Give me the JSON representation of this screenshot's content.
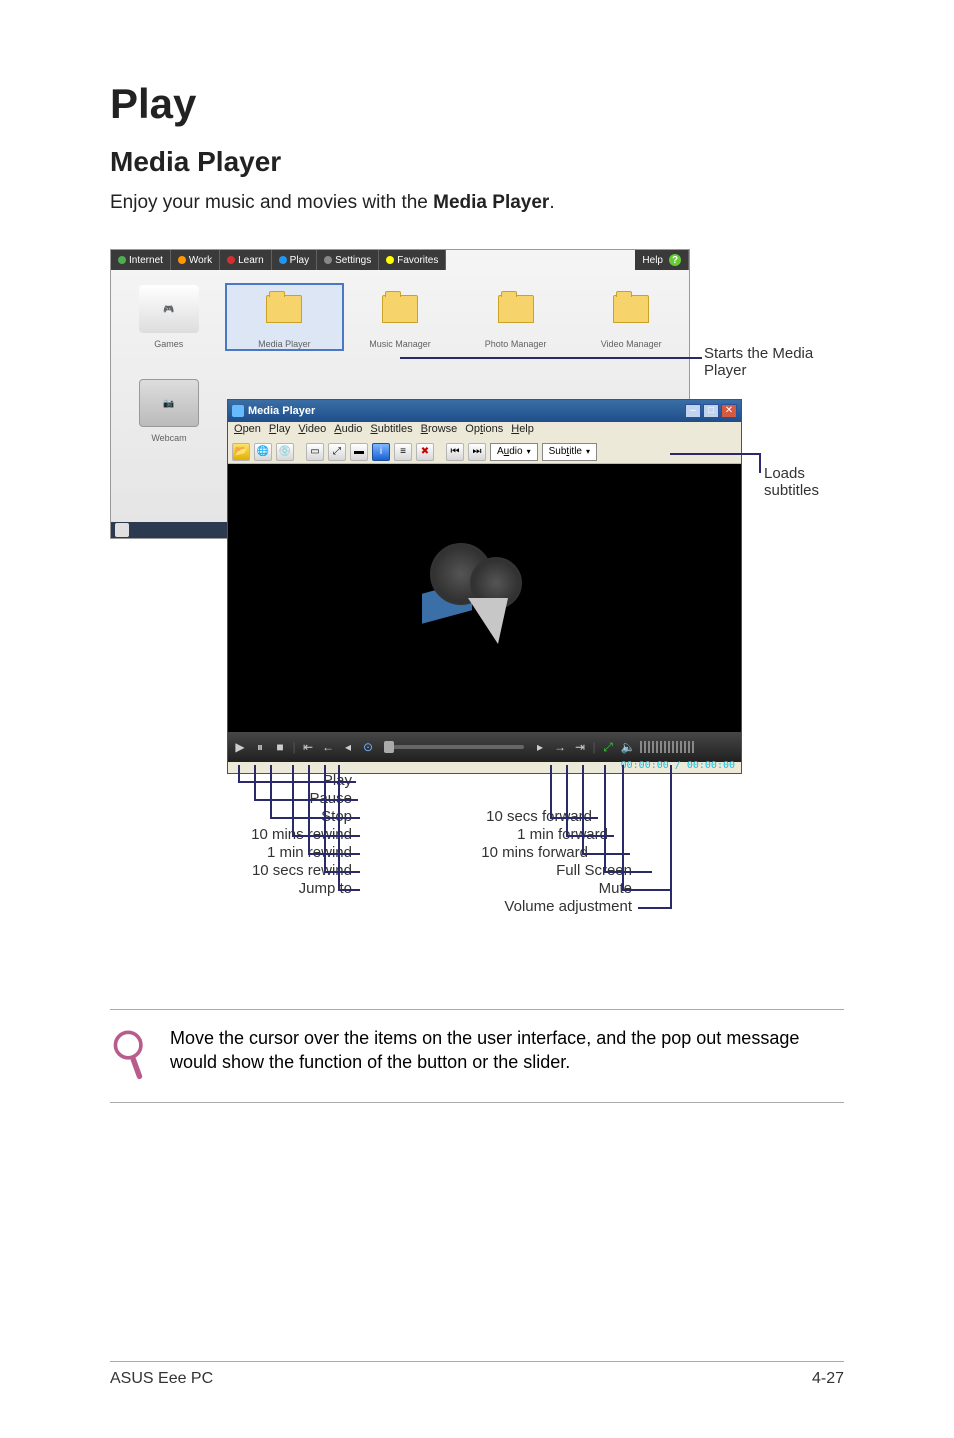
{
  "title": "Play",
  "subtitle": "Media Player",
  "intro_prefix": "Enjoy your music and movies with the ",
  "intro_bold": "Media Player",
  "intro_suffix": ".",
  "desktop": {
    "tabs": [
      "Internet",
      "Work",
      "Learn",
      "Play",
      "Settings",
      "Favorites",
      "Help"
    ],
    "launchers_row1": [
      "Games",
      "Media Player",
      "Music Manager",
      "Photo Manager",
      "Video Manager"
    ],
    "launchers_row2": [
      "Webcam"
    ]
  },
  "media_player": {
    "window_title": "Media Player",
    "menus": [
      "Open",
      "Play",
      "Video",
      "Audio",
      "Subtitles",
      "Browse",
      "Options",
      "Help"
    ],
    "audio_drop": "Audio",
    "subtitle_drop": "Subtitle",
    "time": "00:00:00 / 00:00:00"
  },
  "annotations": {
    "starts": "Starts the Media Player",
    "loads": "Loads subtitles",
    "play": "Play",
    "pause": "Pause",
    "stop": "Stop",
    "rewind10m": "10 mins rewind",
    "rewind1m": "1 min rewind",
    "rewind10s": "10 secs rewind",
    "jump": "Jump to",
    "fwd10s": "10 secs forward",
    "fwd1m": "1 min forward",
    "fwd10m": "10 mins forward",
    "fullscreen": "Full Screen",
    "mute": "Mute",
    "volume": "Volume adjustment"
  },
  "note": "Move the cursor over the items on the user interface, and the pop out message would show the function of the button or the slider.",
  "footer_left": "ASUS Eee PC",
  "footer_right": "4-27"
}
